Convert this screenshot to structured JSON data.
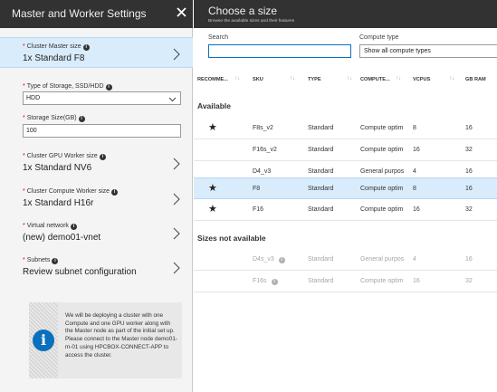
{
  "left_panel": {
    "title": "Master and Worker Settings",
    "close_icon": "close-icon",
    "fields": {
      "master_size": {
        "label": "Cluster Master size",
        "value": "1x Standard F8"
      },
      "storage_type": {
        "label": "Type of Storage, SSD/HDD",
        "value": "HDD"
      },
      "storage_size": {
        "label": "Storage Size(GB)",
        "value": "100"
      },
      "gpu_worker": {
        "label": "Cluster GPU Worker size",
        "value": "1x Standard NV6"
      },
      "compute_worker": {
        "label": "Cluster Compute Worker size",
        "value": "1x Standard H16r"
      },
      "vnet": {
        "label": "Virtual network",
        "value": "(new) demo01-vnet"
      },
      "subnets": {
        "label": "Subnets",
        "value": "Review subnet configuration"
      }
    },
    "info_text": "We will be deploying a cluster with one Compute and one GPU worker along with the Master node as part of the initial set up. Please connect to the Master node demo01-m-01 using HPCBOX-CONNECT-APP to access the cluster."
  },
  "right_panel": {
    "title": "Choose a size",
    "subtitle": "Browse the available sizes and their features",
    "search_label": "Search",
    "search_value": "",
    "compute_type_label": "Compute type",
    "compute_type_value": "Show all compute types",
    "columns": [
      "RECOMME...",
      "SKU",
      "TYPE",
      "COMPUTE...",
      "VCPUS",
      "GB RAM"
    ],
    "section_available": "Available",
    "section_unavailable": "Sizes not available",
    "available_rows": [
      {
        "recommended": true,
        "sku": "F8s_v2",
        "type": "Standard",
        "compute": "Compute optim",
        "vcpus": "8",
        "ram": "16",
        "selected": false
      },
      {
        "recommended": false,
        "sku": "F16s_v2",
        "type": "Standard",
        "compute": "Compute optim",
        "vcpus": "16",
        "ram": "32",
        "selected": false
      },
      {
        "recommended": false,
        "sku": "D4_v3",
        "type": "Standard",
        "compute": "General purpos",
        "vcpus": "4",
        "ram": "16",
        "selected": false
      },
      {
        "recommended": true,
        "sku": "F8",
        "type": "Standard",
        "compute": "Compute optim",
        "vcpus": "8",
        "ram": "16",
        "selected": true
      },
      {
        "recommended": true,
        "sku": "F16",
        "type": "Standard",
        "compute": "Compute optim",
        "vcpus": "16",
        "ram": "32",
        "selected": false
      }
    ],
    "unavailable_rows": [
      {
        "sku": "D4s_v3",
        "type": "Standard",
        "compute": "General purpos",
        "vcpus": "4",
        "ram": "16"
      },
      {
        "sku": "F16s",
        "type": "Standard",
        "compute": "Compute optim",
        "vcpus": "16",
        "ram": "32"
      }
    ]
  },
  "colors": {
    "header_bg": "#323232",
    "selected_bg": "#d9ecfb",
    "accent": "#0a6fbd",
    "required": "#d0021b"
  }
}
